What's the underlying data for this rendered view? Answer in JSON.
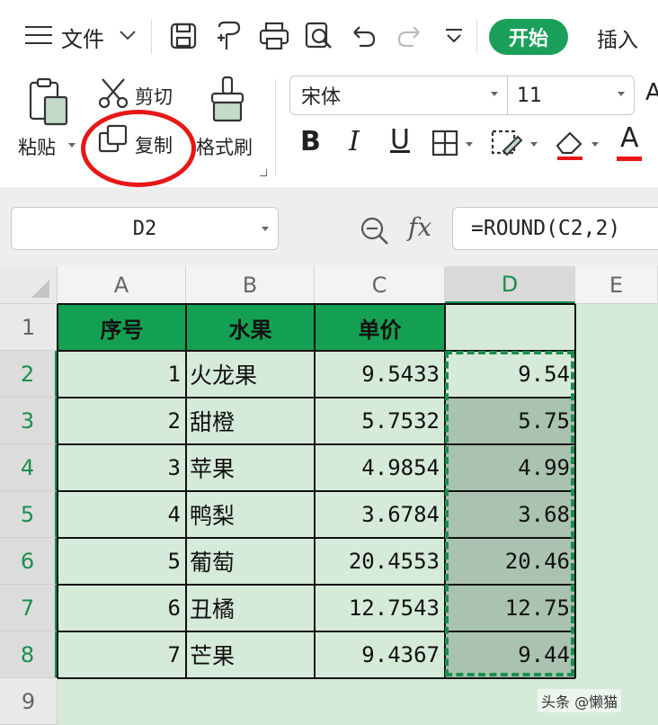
{
  "toolbar": {
    "file_label": "文件",
    "home_tab": "开始",
    "insert_tab": "插入",
    "icons": [
      "menu-icon",
      "save-icon",
      "save-as-icon",
      "print-icon",
      "print-preview-icon",
      "undo-icon",
      "redo-icon",
      "more-icon"
    ]
  },
  "ribbon": {
    "paste_label": "粘贴",
    "cut_label": "剪切",
    "copy_label": "复制",
    "format_painter_label": "格式刷",
    "font_name": "宋体",
    "font_size": "11",
    "bold": "B",
    "italic": "I",
    "underline": "U",
    "font_color_glyph": "A",
    "font_color": "#e81717",
    "highlight_color": "#e81717"
  },
  "formula_bar": {
    "name_box": "D2",
    "fx": "fx",
    "formula": "=ROUND(C2,2)"
  },
  "sheet": {
    "columns": [
      "A",
      "B",
      "C",
      "D",
      "E"
    ],
    "rows": [
      "1",
      "2",
      "3",
      "4",
      "5",
      "6",
      "7",
      "8",
      "9"
    ],
    "header_row": [
      "序号",
      "水果",
      "单价",
      ""
    ],
    "data": [
      {
        "a": "1",
        "b": "火龙果",
        "c": "9.5433",
        "d": "9.54"
      },
      {
        "a": "2",
        "b": "甜橙",
        "c": "5.7532",
        "d": "5.75"
      },
      {
        "a": "3",
        "b": "苹果",
        "c": "4.9854",
        "d": "4.99"
      },
      {
        "a": "4",
        "b": "鸭梨",
        "c": "3.6784",
        "d": "3.68"
      },
      {
        "a": "5",
        "b": "葡萄",
        "c": "20.4553",
        "d": "20.46"
      },
      {
        "a": "6",
        "b": "丑橘",
        "c": "12.7543",
        "d": "12.75"
      },
      {
        "a": "7",
        "b": "芒果",
        "c": "9.4367",
        "d": "9.44"
      }
    ],
    "accent": "#14a052"
  },
  "watermark": "头条 @懒猫"
}
